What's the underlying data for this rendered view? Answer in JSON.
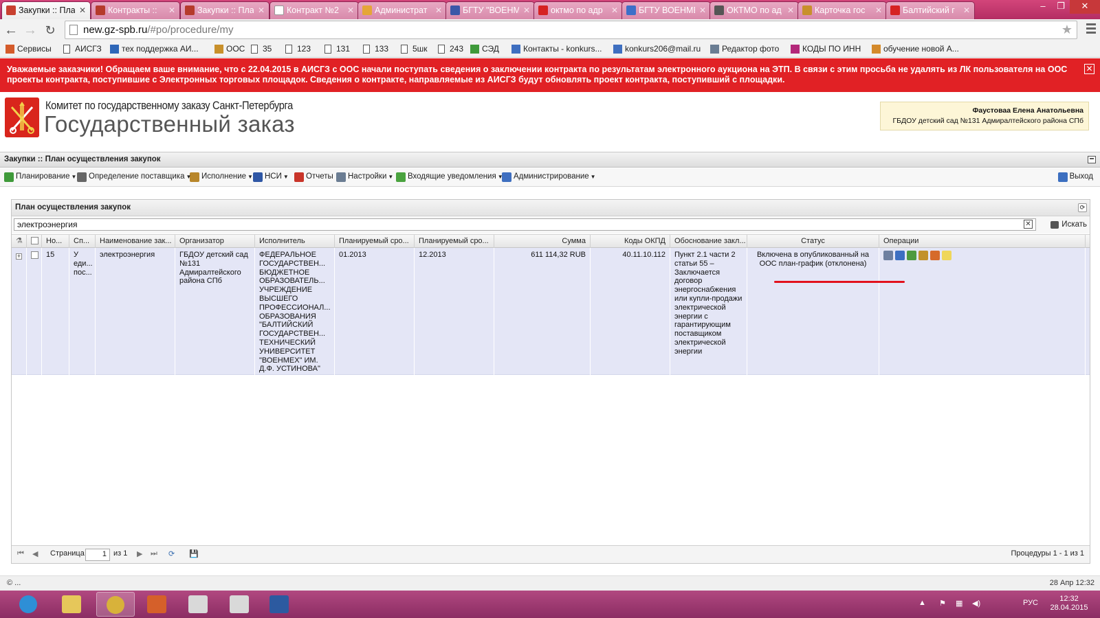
{
  "browser": {
    "tabs": [
      {
        "label": "Закупки :: Пла",
        "color": "#c8402f",
        "active": true
      },
      {
        "label": "Контракты :: ",
        "color": "#b53a2b"
      },
      {
        "label": "Закупки :: Пла",
        "color": "#b53a2b"
      },
      {
        "label": "Контракт №2",
        "color": "#ffffff"
      },
      {
        "label": "Администрат",
        "color": "#e5a637"
      },
      {
        "label": "БГТУ \"ВОЕНМ",
        "color": "#3b57a8"
      },
      {
        "label": "октмо по адр",
        "color": "#d62222"
      },
      {
        "label": "БГТУ ВОЕНМЕ",
        "color": "#3c6fc9"
      },
      {
        "label": "ОКТМО по ад",
        "color": "#555555"
      },
      {
        "label": "Карточка гос",
        "color": "#c8902b"
      },
      {
        "label": "Балтийский г",
        "color": "#d62222"
      }
    ],
    "url_host": "new.gz-spb.ru",
    "url_path": "/#po/procedure/my",
    "bookmarks": [
      {
        "label": "Сервисы",
        "icon": "apps-icon"
      },
      {
        "label": "АИСГЗ",
        "icon": "page-icon"
      },
      {
        "label": "тех поддержка АИ...",
        "icon": "globe-icon"
      },
      {
        "label": "ООС",
        "icon": "emblem-icon"
      },
      {
        "label": "35",
        "icon": "page-icon"
      },
      {
        "label": "123",
        "icon": "page-icon"
      },
      {
        "label": "131",
        "icon": "page-icon"
      },
      {
        "label": "133",
        "icon": "page-icon"
      },
      {
        "label": "5шк",
        "icon": "page-icon"
      },
      {
        "label": "243",
        "icon": "page-icon"
      },
      {
        "label": "СЭД",
        "icon": "sed-icon"
      },
      {
        "label": "Контакты - konkurs...",
        "icon": "mail-icon"
      },
      {
        "label": "konkurs206@mail.ru",
        "icon": "mail-icon"
      },
      {
        "label": "Редактор фото",
        "icon": "photo-icon"
      },
      {
        "label": "КОДЫ ПО ИНН",
        "icon": "codes-icon"
      },
      {
        "label": "обучение новой А...",
        "icon": "training-icon"
      }
    ]
  },
  "notice": {
    "text": "Уважаемые заказчики! Обращаем ваше внимание, что с 22.04.2015 в АИСГЗ с ООС начали поступать сведения о заключении контракта по результатам электронного аукциона на ЭТП. В связи с этим просьба не удалять из ЛК пользователя на ООС проекты контракта, поступившие с Электронных торговых площадок. Сведения о контракте, направляемые из АИСГЗ будут обновлять проект контракта, поступивший с площадки.",
    "close": "✕"
  },
  "header": {
    "org_line1": "Комитет по государственному заказу Санкт-Петербурга",
    "org_line2": "Государственный заказ",
    "user_name": "Фаустоваа Елена Анатольевна",
    "user_org": "ГБДОУ детский сад №131 Адмиралтейского района СПб"
  },
  "module_title": "Закупки :: План осуществления закупок",
  "menu": [
    {
      "label": "Планирование",
      "dropdown": true,
      "icon": "planning-icon",
      "color": "#3f9a3a"
    },
    {
      "label": "Определение поставщика",
      "dropdown": true,
      "icon": "supplier-icon",
      "color": "#666666"
    },
    {
      "label": "Исполнение",
      "dropdown": true,
      "icon": "execution-icon",
      "color": "#b8862a"
    },
    {
      "label": "НСИ",
      "dropdown": true,
      "icon": "nsi-icon",
      "color": "#2f57a5"
    },
    {
      "label": "Отчеты",
      "dropdown": false,
      "icon": "reports-icon",
      "color": "#c9352a"
    },
    {
      "label": "Настройки",
      "dropdown": true,
      "icon": "settings-icon",
      "color": "#6b7d93"
    },
    {
      "label": "Входящие уведомления",
      "dropdown": true,
      "icon": "inbox-icon",
      "color": "#4aa33f"
    },
    {
      "label": "Администрирование",
      "dropdown": true,
      "icon": "admin-icon",
      "color": "#3f6fc0"
    }
  ],
  "exit_label": "Выход",
  "panel": {
    "title": "План осуществления закупок",
    "search_value": "электроэнергия",
    "search_button": "Искать",
    "columns": [
      "",
      "",
      "Но...",
      "Сп...",
      "Наименование зак...",
      "Организатор",
      "Исполнитель",
      "Планируемый сро...",
      "Планируемый сро...",
      "Сумма",
      "Коды ОКПД",
      "Обоснование закл...",
      "Статус",
      "Операции"
    ],
    "row": {
      "number": "15",
      "method": "У еди... пос...",
      "name": "электроэнергия",
      "organizer": "ГБДОУ детский сад №131 Адмиралтейского района СПб",
      "executor": "ФЕДЕРАЛЬНОЕ ГОСУДАРСТВЕН... БЮДЖЕТНОЕ ОБРАЗОВАТЕЛЬ... УЧРЕЖДЕНИЕ ВЫСШЕГО ПРОФЕССИОНАЛ... ОБРАЗОВАНИЯ \"БАЛТИЙСКИЙ ГОСУДАРСТВЕН... ТЕХНИЧЕСКИЙ УНИВЕРСИТЕТ \"ВОЕНМЕХ\" ИМ. Д.Ф. УСТИНОВА\"",
      "planned_start": "01.2013",
      "planned_end": "12.2013",
      "sum": "611 114,32 RUB",
      "okpd": "40.11.10.112",
      "justification": "Пункт 2.1 части 2 статьи 55 – Заключается договор энергоснабжения или купли-продажи электрической энергии с гарантирующим поставщиком электрической энергии",
      "status": "Включена в опубликованный на ООС план-график (отклонена)",
      "operations": [
        {
          "icon": "edit-icon",
          "color": "#6d7fa0"
        },
        {
          "icon": "chart-icon",
          "color": "#3d6fc2"
        },
        {
          "icon": "gears-icon",
          "color": "#4f9a3f"
        },
        {
          "icon": "emblem-icon",
          "color": "#c2912a"
        },
        {
          "icon": "book-icon",
          "color": "#d66a2a"
        },
        {
          "icon": "note-icon",
          "color": "#efd75a"
        }
      ]
    },
    "paging": {
      "page_label": "Страница",
      "page_value": "1",
      "of_label": "из 1",
      "summary": "Процедуры 1 - 1 из 1"
    }
  },
  "statusline": {
    "left": "© ...",
    "right": "28 Апр 12:32"
  },
  "taskbar": {
    "apps": [
      {
        "icon": "ie-icon",
        "color": "#2e8fd6"
      },
      {
        "icon": "explorer-icon",
        "color": "#e6c75a"
      },
      {
        "icon": "chrome-icon",
        "color": "#d8b23a",
        "active": true
      },
      {
        "icon": "media-icon",
        "color": "#d5602a"
      },
      {
        "icon": "key-icon",
        "color": "#d9d9d9"
      },
      {
        "icon": "key2-icon",
        "color": "#d9d9d9"
      },
      {
        "icon": "word-icon",
        "color": "#2c5aa0"
      }
    ],
    "lang": "РУС",
    "time": "12:32",
    "date": "28.04.2015"
  }
}
